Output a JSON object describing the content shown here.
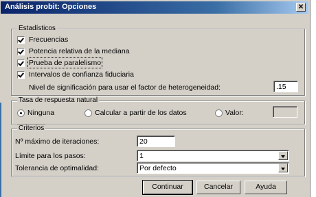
{
  "window": {
    "title": "Análisis probit: Opciones",
    "close_symbol": "✕"
  },
  "statistics": {
    "legend": "Estadísticos",
    "checkboxes": [
      {
        "label": "Frecuencias",
        "checked": true
      },
      {
        "label": "Potencia relativa de la mediana",
        "checked": true
      },
      {
        "label": "Prueba de paralelismo",
        "checked": true
      },
      {
        "label": "Intervalos de confianza fiduciaria",
        "checked": true
      }
    ],
    "heterogeneity_label": "Nivel de significación para usar el factor de heterogeneidad:",
    "heterogeneity_value": ".15"
  },
  "natural_response": {
    "legend": "Tasa de respuesta natural",
    "options": [
      {
        "label": "Ninguna",
        "selected": true
      },
      {
        "label": "Calcular a partir de los datos",
        "selected": false
      },
      {
        "label": "Valor:",
        "selected": false
      }
    ],
    "value_field": ""
  },
  "criteria": {
    "legend": "Criterios",
    "max_iterations_label": "Nº máximo de iteraciones:",
    "max_iterations_value": "20",
    "step_limit_label": "Límite para los pasos:",
    "step_limit_value": "1",
    "tolerance_label": "Tolerancia de optimalidad:",
    "tolerance_value": "Por defecto"
  },
  "buttons": {
    "continue": "Continuar",
    "cancel": "Cancelar",
    "help": "Ayuda"
  }
}
